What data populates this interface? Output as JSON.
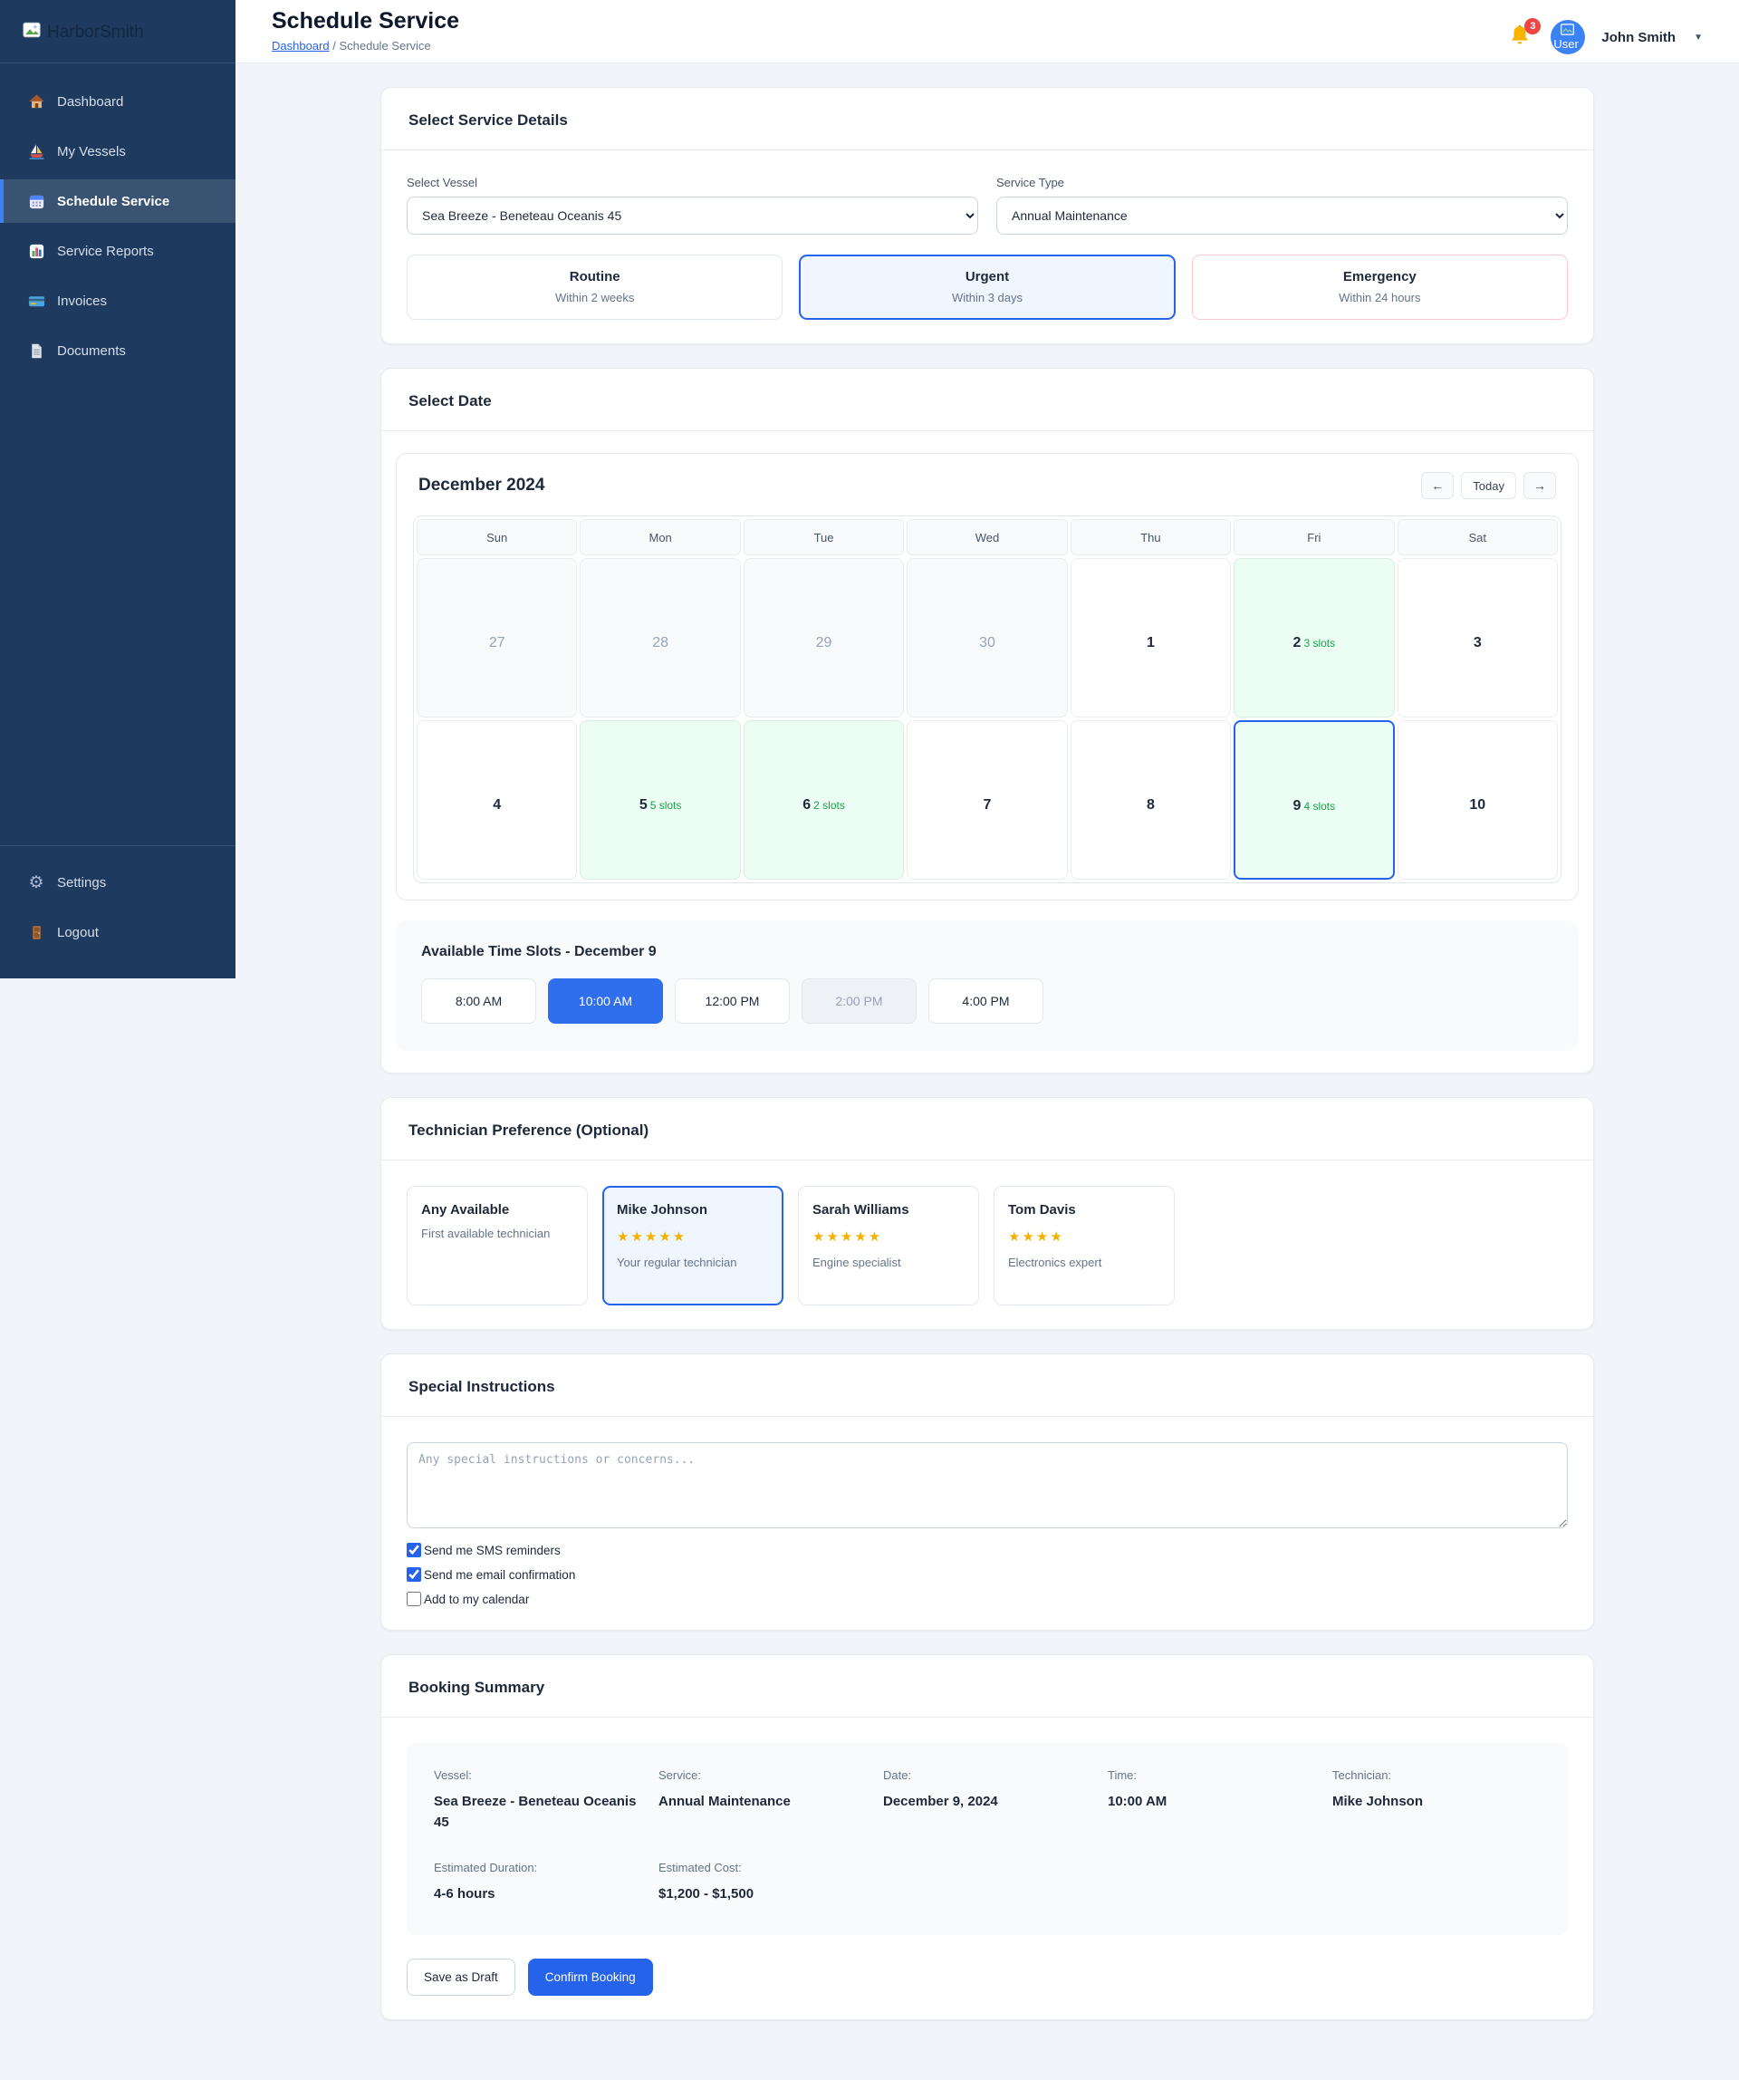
{
  "colors": {
    "accent_blue": "#2563eb",
    "sidebar_navy": "#1e3a5f",
    "badge_red": "#ef4444",
    "available_green": "#16a34a",
    "emergency_border": "#fecaca",
    "star_gold": "#f2b200"
  },
  "sidebar": {
    "logo_alt": "HarborSmith",
    "items": [
      {
        "label": "Dashboard",
        "icon": "house-icon",
        "active": false
      },
      {
        "label": "My Vessels",
        "icon": "sailboat-icon",
        "active": false
      },
      {
        "label": "Schedule Service",
        "icon": "calendar-icon",
        "active": true
      },
      {
        "label": "Service Reports",
        "icon": "bar-chart-icon",
        "active": false
      },
      {
        "label": "Invoices",
        "icon": "credit-card-icon",
        "active": false
      },
      {
        "label": "Documents",
        "icon": "document-icon",
        "active": false
      }
    ],
    "footer_items": [
      {
        "label": "Settings",
        "icon": "gear-icon"
      },
      {
        "label": "Logout",
        "icon": "door-icon"
      }
    ]
  },
  "header": {
    "title": "Schedule Service",
    "breadcrumb": {
      "home": "Dashboard",
      "separator": "/",
      "current": "Schedule Service"
    },
    "notification_count": "3",
    "user": {
      "name": "John Smith",
      "avatar_alt": "User",
      "caret": "▼"
    }
  },
  "service_details": {
    "section_title": "Select Service Details",
    "vessel_label": "Select Vessel",
    "vessel_value": "Sea Breeze - Beneteau Oceanis 45",
    "service_type_label": "Service Type",
    "service_type_value": "Annual Maintenance",
    "urgency_options": [
      {
        "title": "Routine",
        "subtitle": "Within 2 weeks",
        "selected": false
      },
      {
        "title": "Urgent",
        "subtitle": "Within 3 days",
        "selected": true
      },
      {
        "title": "Emergency",
        "subtitle": "Within 24 hours",
        "selected": false
      }
    ]
  },
  "date_section": {
    "section_title": "Select Date",
    "month_label": "December 2024",
    "nav": {
      "prev": "←",
      "today": "Today",
      "next": "→"
    },
    "day_names": [
      "Sun",
      "Mon",
      "Tue",
      "Wed",
      "Thu",
      "Fri",
      "Sat"
    ],
    "days": [
      {
        "day": "27",
        "state": "other-month"
      },
      {
        "day": "28",
        "state": "other-month"
      },
      {
        "day": "29",
        "state": "other-month"
      },
      {
        "day": "30",
        "state": "other-month"
      },
      {
        "day": "1",
        "state": "normal"
      },
      {
        "day": "2",
        "slots": "3 slots",
        "state": "available"
      },
      {
        "day": "3",
        "state": "normal"
      },
      {
        "day": "4",
        "state": "normal"
      },
      {
        "day": "5",
        "slots": "5 slots",
        "state": "available"
      },
      {
        "day": "6",
        "slots": "2 slots",
        "state": "available"
      },
      {
        "day": "7",
        "state": "normal"
      },
      {
        "day": "8",
        "state": "normal"
      },
      {
        "day": "9",
        "slots": "4 slots",
        "state": "available-selected"
      },
      {
        "day": "10",
        "state": "normal"
      }
    ]
  },
  "time_slots": {
    "title": "Available Time Slots - December 9",
    "slots": [
      {
        "label": "8:00 AM",
        "state": "available"
      },
      {
        "label": "10:00 AM",
        "state": "selected"
      },
      {
        "label": "12:00 PM",
        "state": "available"
      },
      {
        "label": "2:00 PM",
        "state": "disabled"
      },
      {
        "label": "4:00 PM",
        "state": "available"
      }
    ]
  },
  "technicians": {
    "section_title": "Technician Preference (Optional)",
    "cards": [
      {
        "name": "Any Available",
        "stars": "",
        "rating": null,
        "desc": "First available technician",
        "selected": false
      },
      {
        "name": "Mike Johnson",
        "stars": "★★★★★",
        "rating": 5,
        "desc": "Your regular technician",
        "selected": true
      },
      {
        "name": "Sarah Williams",
        "stars": "★★★★★",
        "rating": 5,
        "desc": "Engine specialist",
        "selected": false
      },
      {
        "name": "Tom Davis",
        "stars": "★★★★",
        "rating": 4,
        "desc": "Electronics expert",
        "selected": false
      }
    ]
  },
  "instructions": {
    "section_title": "Special Instructions",
    "placeholder": "Any special instructions or concerns...",
    "options": [
      {
        "label": "Send me SMS reminders",
        "checked": true
      },
      {
        "label": "Send me email confirmation",
        "checked": true
      },
      {
        "label": "Add to my calendar",
        "checked": false
      }
    ]
  },
  "summary": {
    "section_title": "Booking Summary",
    "fields": [
      {
        "label": "Vessel:",
        "value": "Sea Breeze - Beneteau Oceanis 45"
      },
      {
        "label": "Service:",
        "value": "Annual Maintenance"
      },
      {
        "label": "Date:",
        "value": "December 9, 2024"
      },
      {
        "label": "Time:",
        "value": "10:00 AM"
      },
      {
        "label": "Technician:",
        "value": "Mike Johnson"
      },
      {
        "label": "Estimated Duration:",
        "value": "4-6 hours"
      },
      {
        "label": "Estimated Cost:",
        "value": "$1,200 - $1,500"
      }
    ]
  },
  "actions": {
    "save_draft": "Save as Draft",
    "confirm": "Confirm Booking"
  }
}
